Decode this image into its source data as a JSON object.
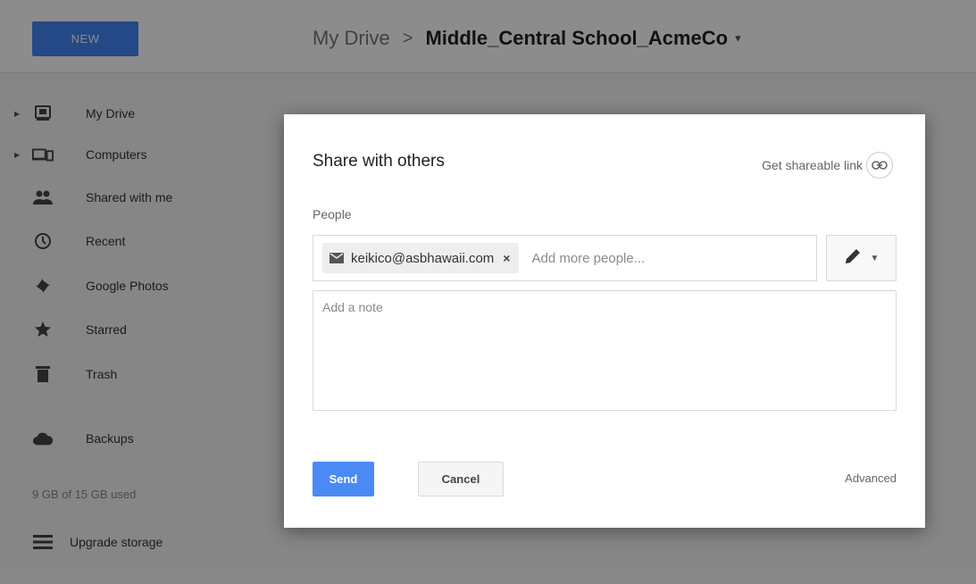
{
  "app": {
    "new_button": "NEW",
    "breadcrumb": {
      "root": "My Drive",
      "separator": ">",
      "folder": "Middle_Central School_AcmeCo",
      "caret": "▾"
    }
  },
  "sidebar": {
    "items": [
      {
        "label": "My Drive",
        "icon": "drive-icon",
        "expandable": true
      },
      {
        "label": "Computers",
        "icon": "computers-icon",
        "expandable": true
      },
      {
        "label": "Shared with me",
        "icon": "people-icon",
        "expandable": false
      },
      {
        "label": "Recent",
        "icon": "clock-icon",
        "expandable": false
      },
      {
        "label": "Google Photos",
        "icon": "pinwheel-icon",
        "expandable": false
      },
      {
        "label": "Starred",
        "icon": "star-icon",
        "expandable": false
      },
      {
        "label": "Trash",
        "icon": "trash-icon",
        "expandable": false
      },
      {
        "label": "Backups",
        "icon": "cloud-icon",
        "expandable": false
      }
    ],
    "storage_text": "9 GB of 15 GB used",
    "upgrade_label": "Upgrade storage"
  },
  "dialog": {
    "title": "Share with others",
    "shareable_link_label": "Get shareable link",
    "people_label": "People",
    "chip_email": "keikico@asbhawaii.com",
    "chip_remove": "×",
    "add_people_placeholder": "Add more people...",
    "note_placeholder": "Add a note",
    "send_label": "Send",
    "cancel_label": "Cancel",
    "advanced_label": "Advanced"
  },
  "colors": {
    "accent": "#4285f4",
    "overlay": "rgba(0,0,0,0.45)"
  }
}
